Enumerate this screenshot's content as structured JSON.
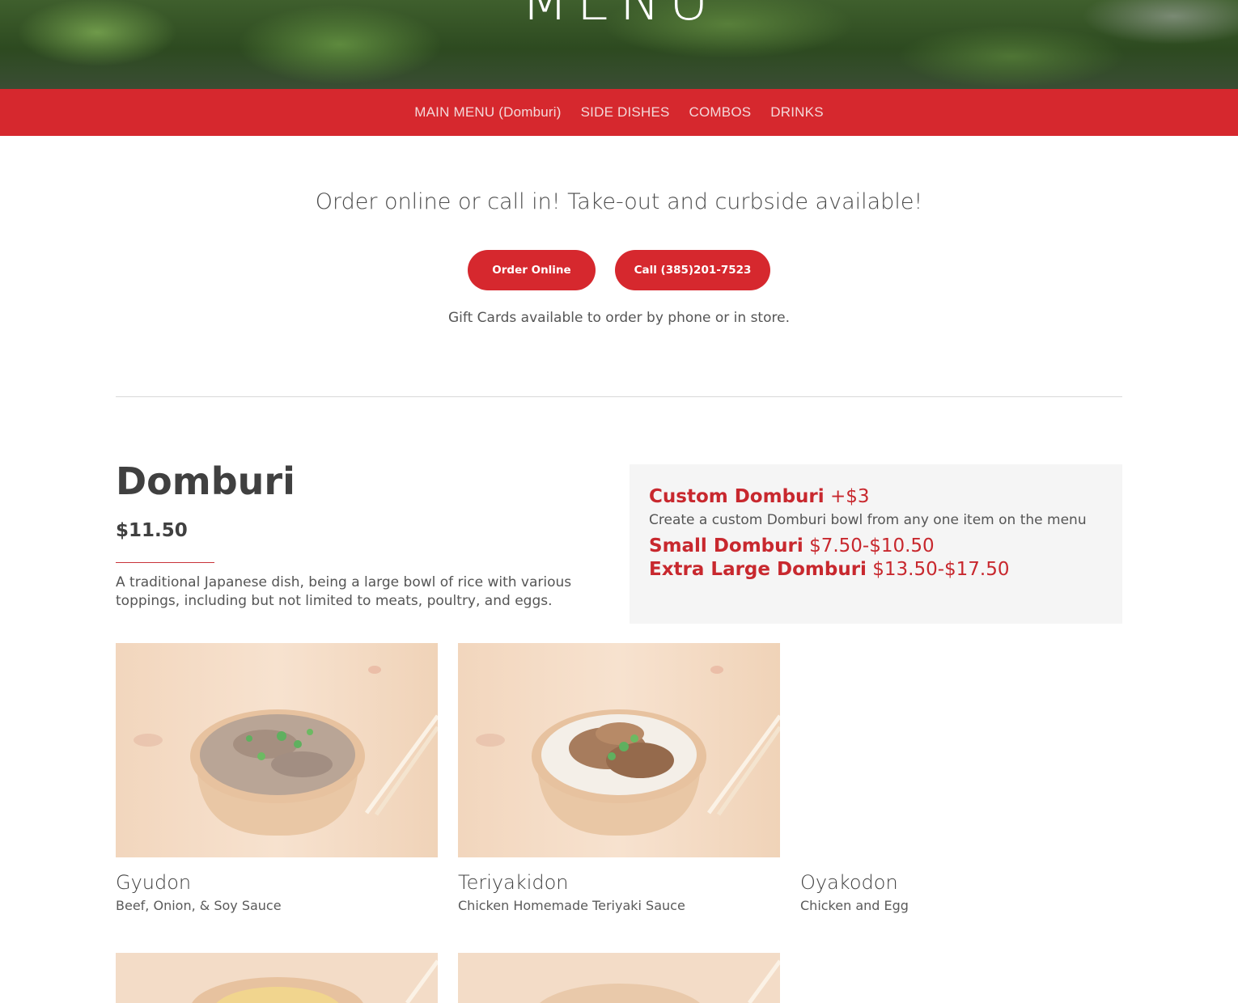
{
  "hero": {
    "title": "MENU"
  },
  "nav": {
    "items": [
      {
        "label": "MAIN MENU (Domburi)"
      },
      {
        "label": "SIDE DISHES"
      },
      {
        "label": "COMBOS"
      },
      {
        "label": "DRINKS"
      }
    ]
  },
  "intro": {
    "tagline": "Order online or call in! Take-out and curbside available!",
    "order_button": "Order Online",
    "call_button": "Call (385)201-7523",
    "giftcards": "Gift Cards available to order by phone or in store."
  },
  "domburi": {
    "title": "Domburi",
    "price": "$11.50",
    "description": "A traditional Japanese dish, being a large bowl of rice with various toppings, including but not limited to meats, poultry, and eggs.",
    "custom": {
      "title": "Custom Domburi",
      "price": "+$3",
      "description": "Create a custom Domburi bowl from any one item on the menu",
      "small_label": "Small Domburi",
      "small_price": "$7.50-$10.50",
      "xl_label": "Extra Large Domburi",
      "xl_price": "$13.50-$17.50"
    }
  },
  "items": [
    {
      "name": "Gyudon",
      "description": "Beef, Onion, & Soy Sauce",
      "image": "beef-bowl-photo"
    },
    {
      "name": "Teriyakidon",
      "description": "Chicken Homemade Teriyaki Sauce",
      "image": "teriyaki-bowl-photo"
    },
    {
      "name": "Oyakodon",
      "description": "Chicken and Egg",
      "image": ""
    }
  ],
  "colors": {
    "brand_red": "#d6282e",
    "text_dark": "#404040",
    "panel_bg": "#f5f5f5"
  }
}
